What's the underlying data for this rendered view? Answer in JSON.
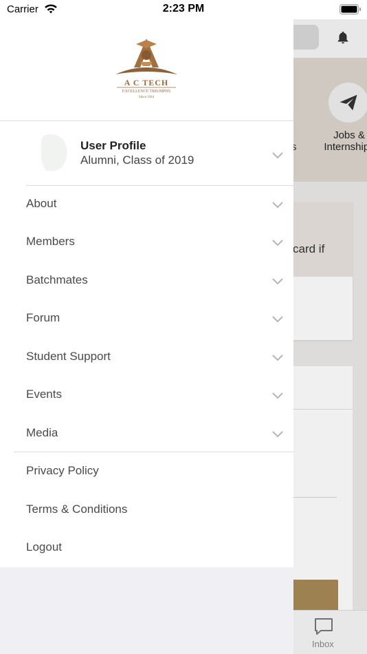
{
  "status_bar": {
    "carrier": "Carrier",
    "time": "2:23 PM"
  },
  "drawer": {
    "logo": {
      "title": "A C TECH",
      "tagline": "EXCELLENCE TRIUMPHS",
      "since": "Since 1944"
    },
    "profile": {
      "name": "User Profile",
      "subtitle": "Alumni, Class of 2019"
    },
    "menu_items": [
      {
        "label": "About"
      },
      {
        "label": "Members"
      },
      {
        "label": "Batchmates"
      },
      {
        "label": "Forum"
      },
      {
        "label": "Student Support"
      },
      {
        "label": "Events"
      },
      {
        "label": "Media"
      }
    ],
    "footer_items": [
      {
        "label": "Privacy Policy"
      },
      {
        "label": "Terms & Conditions"
      },
      {
        "label": "Logout"
      }
    ]
  },
  "background": {
    "jobs_label": "Jobs & Internships",
    "partial_s": "s",
    "card_text": "card if",
    "tab_inbox": "Inbox"
  },
  "colors": {
    "brand": "#9a6d3f",
    "gold_button": "#a88a55"
  },
  "icons": [
    "wifi-icon",
    "battery-icon",
    "bell-icon",
    "paper-plane-icon",
    "chevron-down-icon",
    "inbox-icon"
  ]
}
